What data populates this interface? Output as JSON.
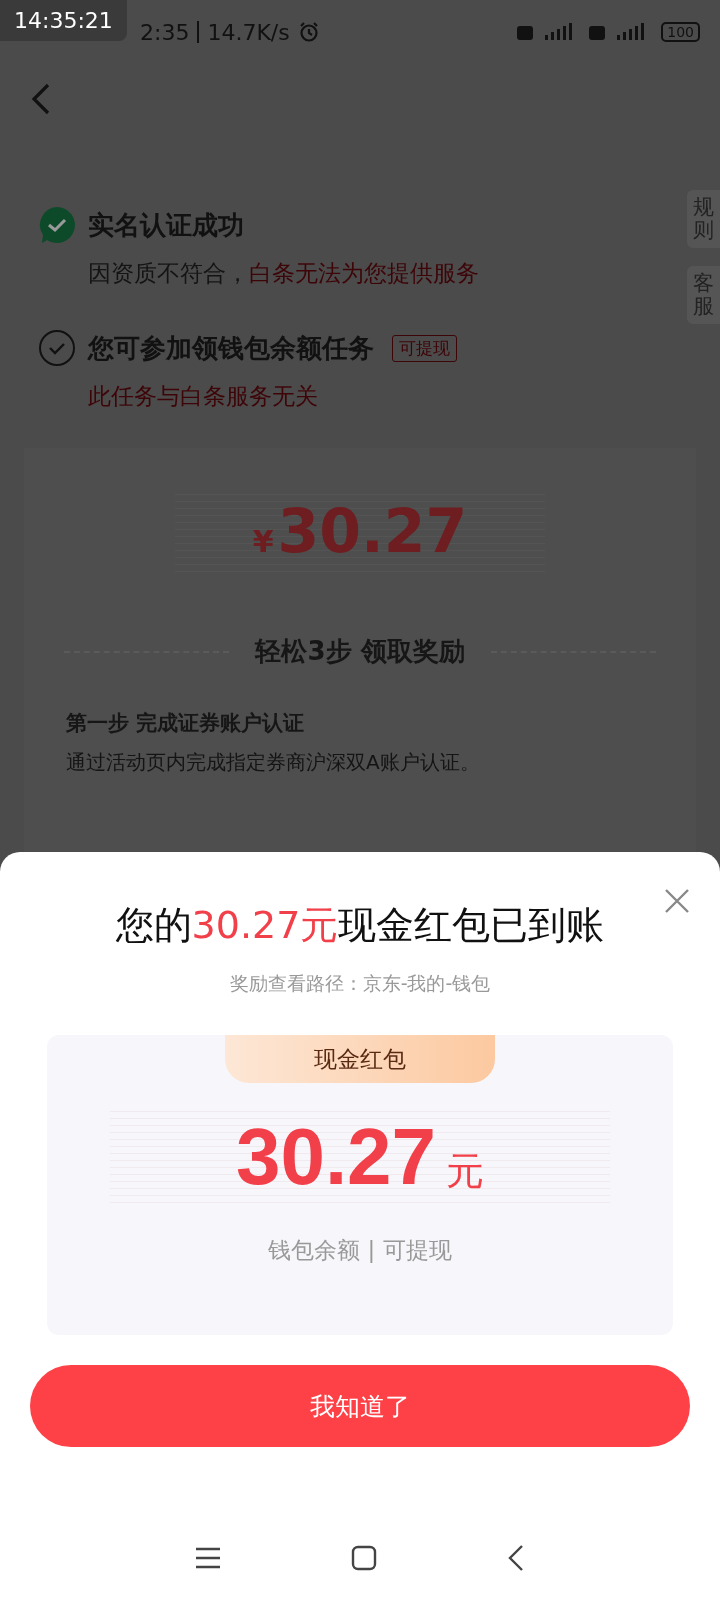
{
  "status_bar": {
    "clock_overlay": "14:35:21",
    "time": "2:35",
    "speed": "14.7K/s",
    "battery": "100"
  },
  "side_tabs": [
    "规则",
    "客服"
  ],
  "items": [
    {
      "title": "实名认证成功",
      "checked": true,
      "note": [
        {
          "text": "因资质不符合，",
          "kind": "muted"
        },
        {
          "text": "白条无法为您提供服务",
          "kind": "alert"
        }
      ]
    },
    {
      "title": "您可参加领钱包余额任务",
      "checked": false,
      "tag": "可提现",
      "note": [
        {
          "text": "此任务与白条服务无关",
          "kind": "alert"
        }
      ]
    }
  ],
  "reward": {
    "currency": "¥",
    "amount": "30.27",
    "heading": "轻松3步 领取奖励",
    "step_title": "第一步 完成证券账户认证",
    "step_desc": "通过活动页内完成指定券商沪深双A账户认证。"
  },
  "modal": {
    "title": [
      {
        "text": "您的",
        "kind": "plain"
      },
      {
        "text": "30.27元",
        "kind": "accent"
      },
      {
        "text": "现金红包已到账",
        "kind": "plain"
      }
    ],
    "subtitle": "奖励查看路径：京东-我的-钱包",
    "card": {
      "ribbon": "现金红包",
      "amount": "30.27",
      "unit": "元",
      "footer": "钱包余额 | 可提现"
    },
    "button": "我知道了"
  }
}
